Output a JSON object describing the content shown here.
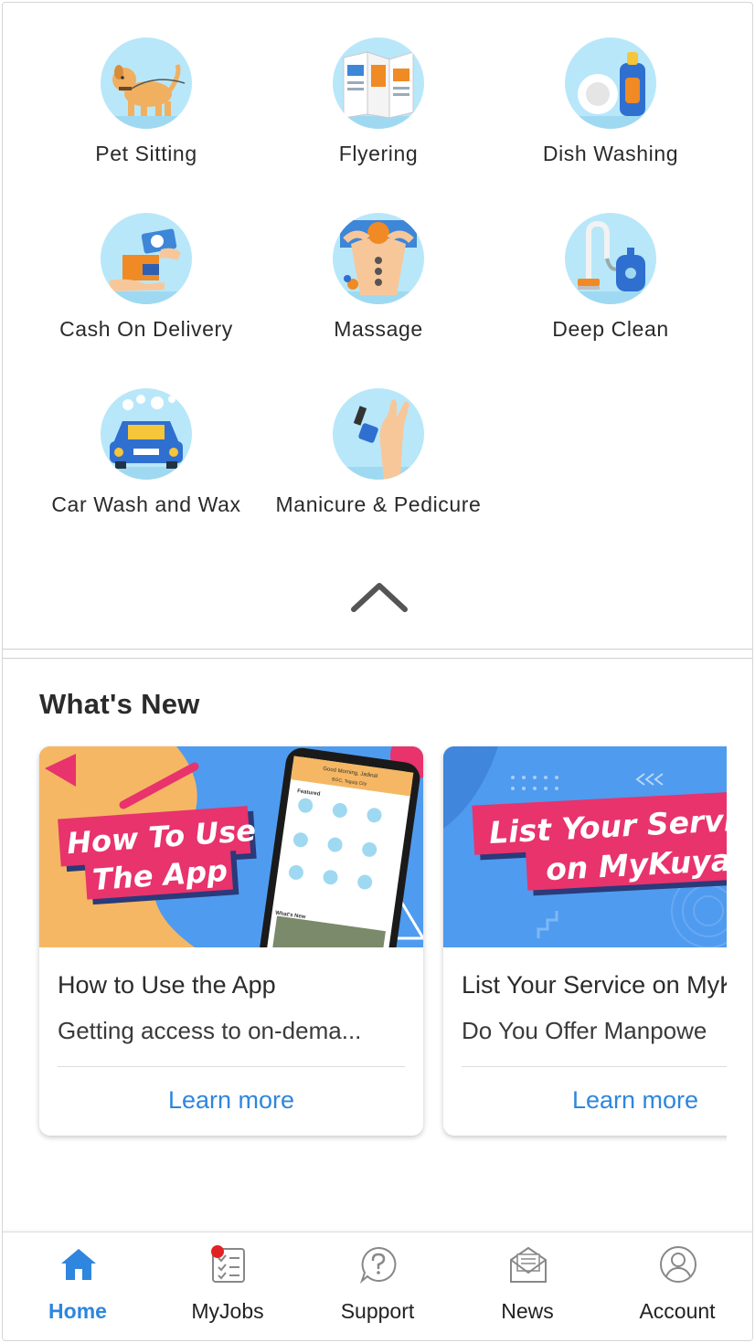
{
  "services": [
    {
      "label": "Pet Sitting",
      "icon": "dog-icon"
    },
    {
      "label": "Flyering",
      "icon": "flyer-icon"
    },
    {
      "label": "Dish Washing",
      "icon": "dish-soap-icon"
    },
    {
      "label": "Cash On Delivery",
      "icon": "cash-delivery-icon"
    },
    {
      "label": "Massage",
      "icon": "massage-icon"
    },
    {
      "label": "Deep Clean",
      "icon": "vacuum-icon"
    },
    {
      "label": "Car Wash and Wax",
      "icon": "car-wash-icon"
    },
    {
      "label": "Manicure & Pedicure",
      "icon": "nail-polish-icon"
    }
  ],
  "whats_new": {
    "title": "What's New",
    "cards": [
      {
        "banner_line1": "How To Use",
        "banner_line2": "The App",
        "phone_greeting": "Good Morning, Jadinal",
        "phone_location": "BGC, Taguig City",
        "phone_featured": "Featured",
        "phone_whats_new": "What's New",
        "title": "How to Use the App",
        "description": "Getting access to on-dema...",
        "link": "Learn more"
      },
      {
        "banner_line1": "List Your Servi",
        "banner_line2": "on MyKuya",
        "title": "List Your Service on MyK",
        "description": "Do You Offer Manpowe",
        "link": "Learn more"
      }
    ]
  },
  "nav": {
    "items": [
      {
        "label": "Home",
        "icon": "home-icon",
        "active": true
      },
      {
        "label": "MyJobs",
        "icon": "checklist-icon",
        "active": false
      },
      {
        "label": "Support",
        "icon": "help-icon",
        "active": false
      },
      {
        "label": "News",
        "icon": "envelope-icon",
        "active": false
      },
      {
        "label": "Account",
        "icon": "user-icon",
        "active": false
      }
    ]
  },
  "colors": {
    "accent": "#2e86de",
    "icon_bg": "#b8e7fa",
    "banner_pink": "#e8336d",
    "badge": "#e02424"
  }
}
